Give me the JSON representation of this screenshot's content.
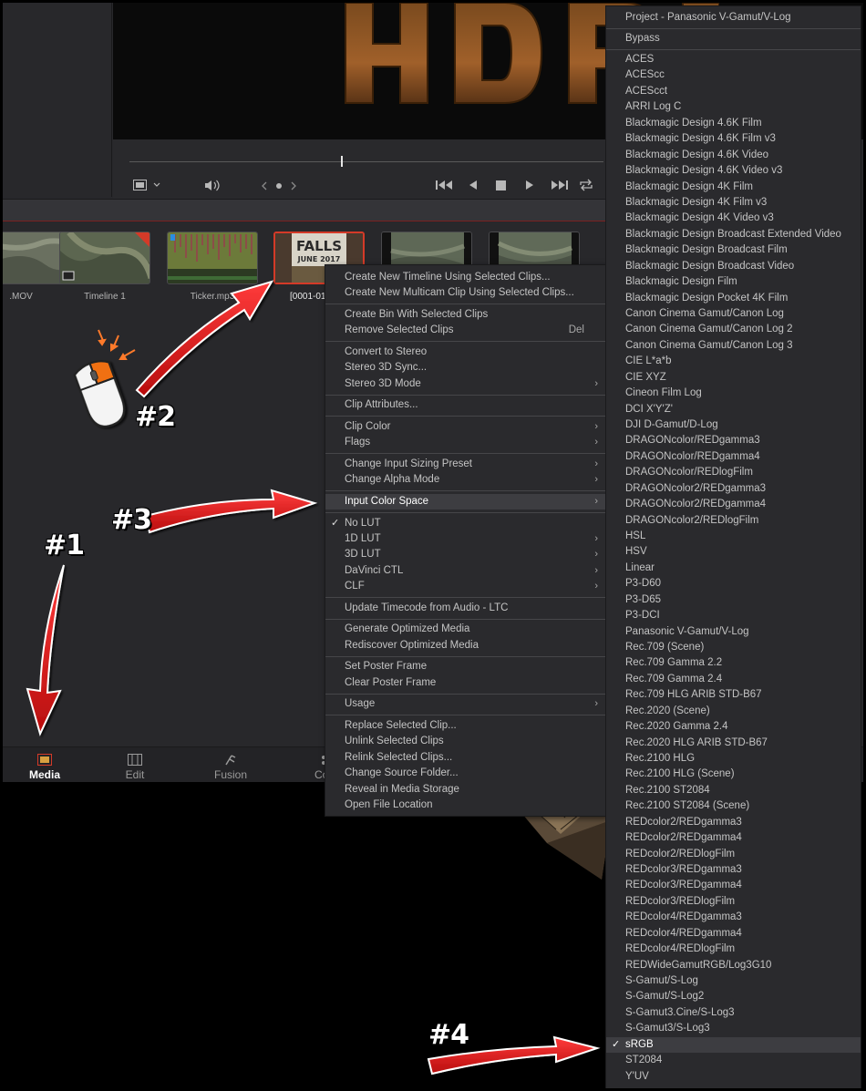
{
  "clips": [
    {
      "name": ".MOV",
      "selected": false
    },
    {
      "name": "Timeline 1",
      "selected": false
    },
    {
      "name": "Ticker.mp3",
      "selected": false
    },
    {
      "name": "[0001-01",
      "selected": true
    },
    {
      "name": "",
      "selected": false
    },
    {
      "name": "",
      "selected": false
    }
  ],
  "page_tabs": [
    {
      "label": "Media",
      "icon": "media-icon",
      "active": true
    },
    {
      "label": "Edit",
      "icon": "edit-icon",
      "active": false
    },
    {
      "label": "Fusion",
      "icon": "fusion-icon",
      "active": false
    },
    {
      "label": "Co",
      "icon": "color-icon",
      "active": false
    }
  ],
  "context_menu": {
    "groups": [
      [
        {
          "label": "Create New Timeline Using Selected Clips..."
        },
        {
          "label": "Create New Multicam Clip Using Selected Clips..."
        }
      ],
      [
        {
          "label": "Create Bin With Selected Clips"
        },
        {
          "label": "Remove Selected Clips",
          "shortcut": "Del"
        }
      ],
      [
        {
          "label": "Convert to Stereo"
        },
        {
          "label": "Stereo 3D Sync..."
        },
        {
          "label": "Stereo 3D Mode",
          "submenu": true
        }
      ],
      [
        {
          "label": "Clip Attributes..."
        }
      ],
      [
        {
          "label": "Clip Color",
          "submenu": true
        },
        {
          "label": "Flags",
          "submenu": true
        }
      ],
      [
        {
          "label": "Change Input Sizing Preset",
          "submenu": true
        },
        {
          "label": "Change Alpha Mode",
          "submenu": true
        }
      ],
      [
        {
          "label": "Input Color Space",
          "submenu": true,
          "highlighted": true
        }
      ],
      [
        {
          "label": "No LUT",
          "checked": true
        },
        {
          "label": "1D LUT",
          "submenu": true
        },
        {
          "label": "3D LUT",
          "submenu": true
        },
        {
          "label": "DaVinci CTL",
          "submenu": true
        },
        {
          "label": "CLF",
          "submenu": true
        }
      ],
      [
        {
          "label": "Update Timecode from Audio - LTC"
        }
      ],
      [
        {
          "label": "Generate Optimized Media"
        },
        {
          "label": "Rediscover Optimized Media"
        }
      ],
      [
        {
          "label": "Set Poster Frame"
        },
        {
          "label": "Clear Poster Frame"
        }
      ],
      [
        {
          "label": "Usage",
          "submenu": true
        }
      ],
      [
        {
          "label": "Replace Selected Clip..."
        },
        {
          "label": "Unlink Selected Clips"
        },
        {
          "label": "Relink Selected Clips..."
        },
        {
          "label": "Change Source Folder..."
        },
        {
          "label": "Reveal in Media Storage"
        },
        {
          "label": "Open File Location"
        }
      ]
    ]
  },
  "color_space_menu": {
    "groups": [
      [
        "Project - Panasonic V-Gamut/V-Log"
      ],
      [
        "Bypass"
      ],
      [
        "ACES",
        "ACEScc",
        "ACEScct",
        "ARRI Log C",
        "Blackmagic Design 4.6K Film",
        "Blackmagic Design 4.6K Film v3",
        "Blackmagic Design 4.6K Video",
        "Blackmagic Design 4.6K Video v3",
        "Blackmagic Design 4K Film",
        "Blackmagic Design 4K Film v3",
        "Blackmagic Design 4K Video v3",
        "Blackmagic Design Broadcast Extended Video",
        "Blackmagic Design Broadcast Film",
        "Blackmagic Design Broadcast Video",
        "Blackmagic Design Film",
        "Blackmagic Design Pocket 4K Film",
        "Canon Cinema Gamut/Canon Log",
        "Canon Cinema Gamut/Canon Log 2",
        "Canon Cinema Gamut/Canon Log 3",
        "CIE L*a*b",
        "CIE XYZ",
        "Cineon Film Log",
        "DCI X'Y'Z'",
        "DJI D-Gamut/D-Log",
        "DRAGONcolor/REDgamma3",
        "DRAGONcolor/REDgamma4",
        "DRAGONcolor/REDlogFilm",
        "DRAGONcolor2/REDgamma3",
        "DRAGONcolor2/REDgamma4",
        "DRAGONcolor2/REDlogFilm",
        "HSL",
        "HSV",
        "Linear",
        "P3-D60",
        "P3-D65",
        "P3-DCI",
        "Panasonic V-Gamut/V-Log",
        "Rec.709 (Scene)",
        "Rec.709 Gamma 2.2",
        "Rec.709 Gamma 2.4",
        "Rec.709 HLG ARIB STD-B67",
        "Rec.2020 (Scene)",
        "Rec.2020 Gamma 2.4",
        "Rec.2020 HLG ARIB STD-B67",
        "Rec.2100 HLG",
        "Rec.2100 HLG (Scene)",
        "Rec.2100 ST2084",
        "Rec.2100 ST2084 (Scene)",
        "REDcolor2/REDgamma3",
        "REDcolor2/REDgamma4",
        "REDcolor2/REDlogFilm",
        "REDcolor3/REDgamma3",
        "REDcolor3/REDgamma4",
        "REDcolor3/REDlogFilm",
        "REDcolor4/REDgamma3",
        "REDcolor4/REDgamma4",
        "REDcolor4/REDlogFilm",
        "REDWideGamutRGB/Log3G10",
        "S-Gamut/S-Log",
        "S-Gamut/S-Log2",
        "S-Gamut3.Cine/S-Log3",
        "S-Gamut3/S-Log3",
        "sRGB",
        "ST2084",
        "Y'UV"
      ]
    ],
    "selected": "sRGB"
  },
  "annotations": {
    "step1": "#1",
    "step2": "#2",
    "step3": "#3",
    "step4": "#4"
  },
  "colors": {
    "accent_red": "#d43a28",
    "arrow_red": "#e0191a",
    "menu_bg": "#2a2a2d",
    "menu_highlight": "#3d3d41"
  }
}
